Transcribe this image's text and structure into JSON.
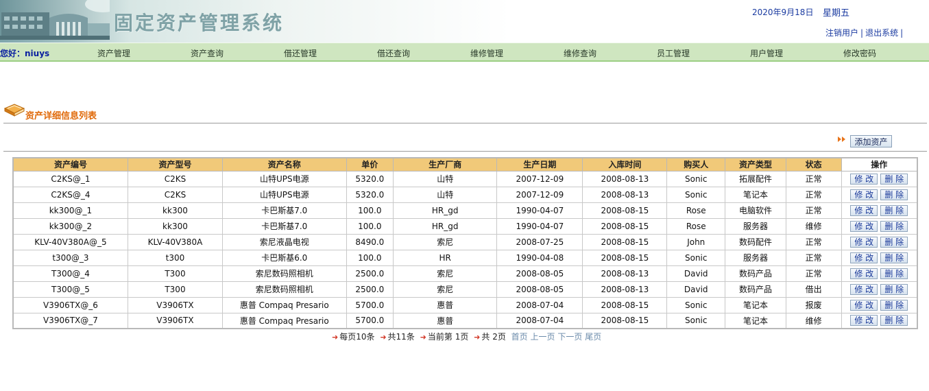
{
  "header": {
    "title": "固定资产管理系统",
    "date": "2020年9月18日",
    "weekday": "星期五",
    "logout_user": "注销用户",
    "exit_system": "退出系统",
    "sep": "|"
  },
  "nav": {
    "greeting": "您好：niuys",
    "items": [
      "资产管理",
      "资产查询",
      "借还管理",
      "借还查询",
      "维修管理",
      "维修查询",
      "员工管理",
      "用户管理",
      "修改密码"
    ]
  },
  "section": {
    "title": "资产详细信息列表",
    "add_button": "添加资产"
  },
  "table": {
    "columns": [
      "资产编号",
      "资产型号",
      "资产名称",
      "单价",
      "生产厂商",
      "生产日期",
      "入库时间",
      "购买人",
      "资产类型",
      "状态",
      "操作"
    ],
    "edit_label": "修 改",
    "delete_label": "删 除",
    "rows": [
      [
        "C2KS@_1",
        "C2KS",
        "山特UPS电源",
        "5320.0",
        "山特",
        "2007-12-09",
        "2008-08-13",
        "Sonic",
        "拓展配件",
        "正常"
      ],
      [
        "C2KS@_4",
        "C2KS",
        "山特UPS电源",
        "5320.0",
        "山特",
        "2007-12-09",
        "2008-08-13",
        "Sonic",
        "笔记本",
        "正常"
      ],
      [
        "kk300@_1",
        "kk300",
        "卡巴斯基7.0",
        "100.0",
        "HR_gd",
        "1990-04-07",
        "2008-08-15",
        "Rose",
        "电脑软件",
        "正常"
      ],
      [
        "kk300@_2",
        "kk300",
        "卡巴斯基7.0",
        "100.0",
        "HR_gd",
        "1990-04-07",
        "2008-08-15",
        "Rose",
        "服务器",
        "维修"
      ],
      [
        "KLV-40V380A@_5",
        "KLV-40V380A",
        "索尼液晶电视",
        "8490.0",
        "索尼",
        "2008-07-25",
        "2008-08-15",
        "John",
        "数码配件",
        "正常"
      ],
      [
        "t300@_3",
        "t300",
        "卡巴斯基6.0",
        "100.0",
        "HR",
        "1990-04-08",
        "2008-08-15",
        "Sonic",
        "服务器",
        "正常"
      ],
      [
        "T300@_4",
        "T300",
        "索尼数码照相机",
        "2500.0",
        "索尼",
        "2008-08-05",
        "2008-08-13",
        "David",
        "数码产品",
        "正常"
      ],
      [
        "T300@_5",
        "T300",
        "索尼数码照相机",
        "2500.0",
        "索尼",
        "2008-08-05",
        "2008-08-13",
        "David",
        "数码产品",
        "借出"
      ],
      [
        "V3906TX@_6",
        "V3906TX",
        "惠普 Compaq Presario",
        "5700.0",
        "惠普",
        "2008-07-04",
        "2008-08-15",
        "Sonic",
        "笔记本",
        "报废"
      ],
      [
        "V3906TX@_7",
        "V3906TX",
        "惠普 Compaq Presario",
        "5700.0",
        "惠普",
        "2008-07-04",
        "2008-08-15",
        "Sonic",
        "笔记本",
        "维修"
      ]
    ]
  },
  "pager": {
    "per_page": "每页10条",
    "total": "共11条",
    "current": "当前第 1页",
    "pages": "共 2页",
    "first": "首页",
    "prev": "上一页",
    "next": "下一页",
    "last": "尾页"
  },
  "icons": {
    "section": "book-icon",
    "add": "double-chevron-icon",
    "pager": "arrow-bullet-icon"
  },
  "colors": {
    "accent_orange": "#e06a0a",
    "nav_green": "#cfe6c0",
    "table_header": "#f1c979",
    "link_blue": "#1a3aa0"
  }
}
